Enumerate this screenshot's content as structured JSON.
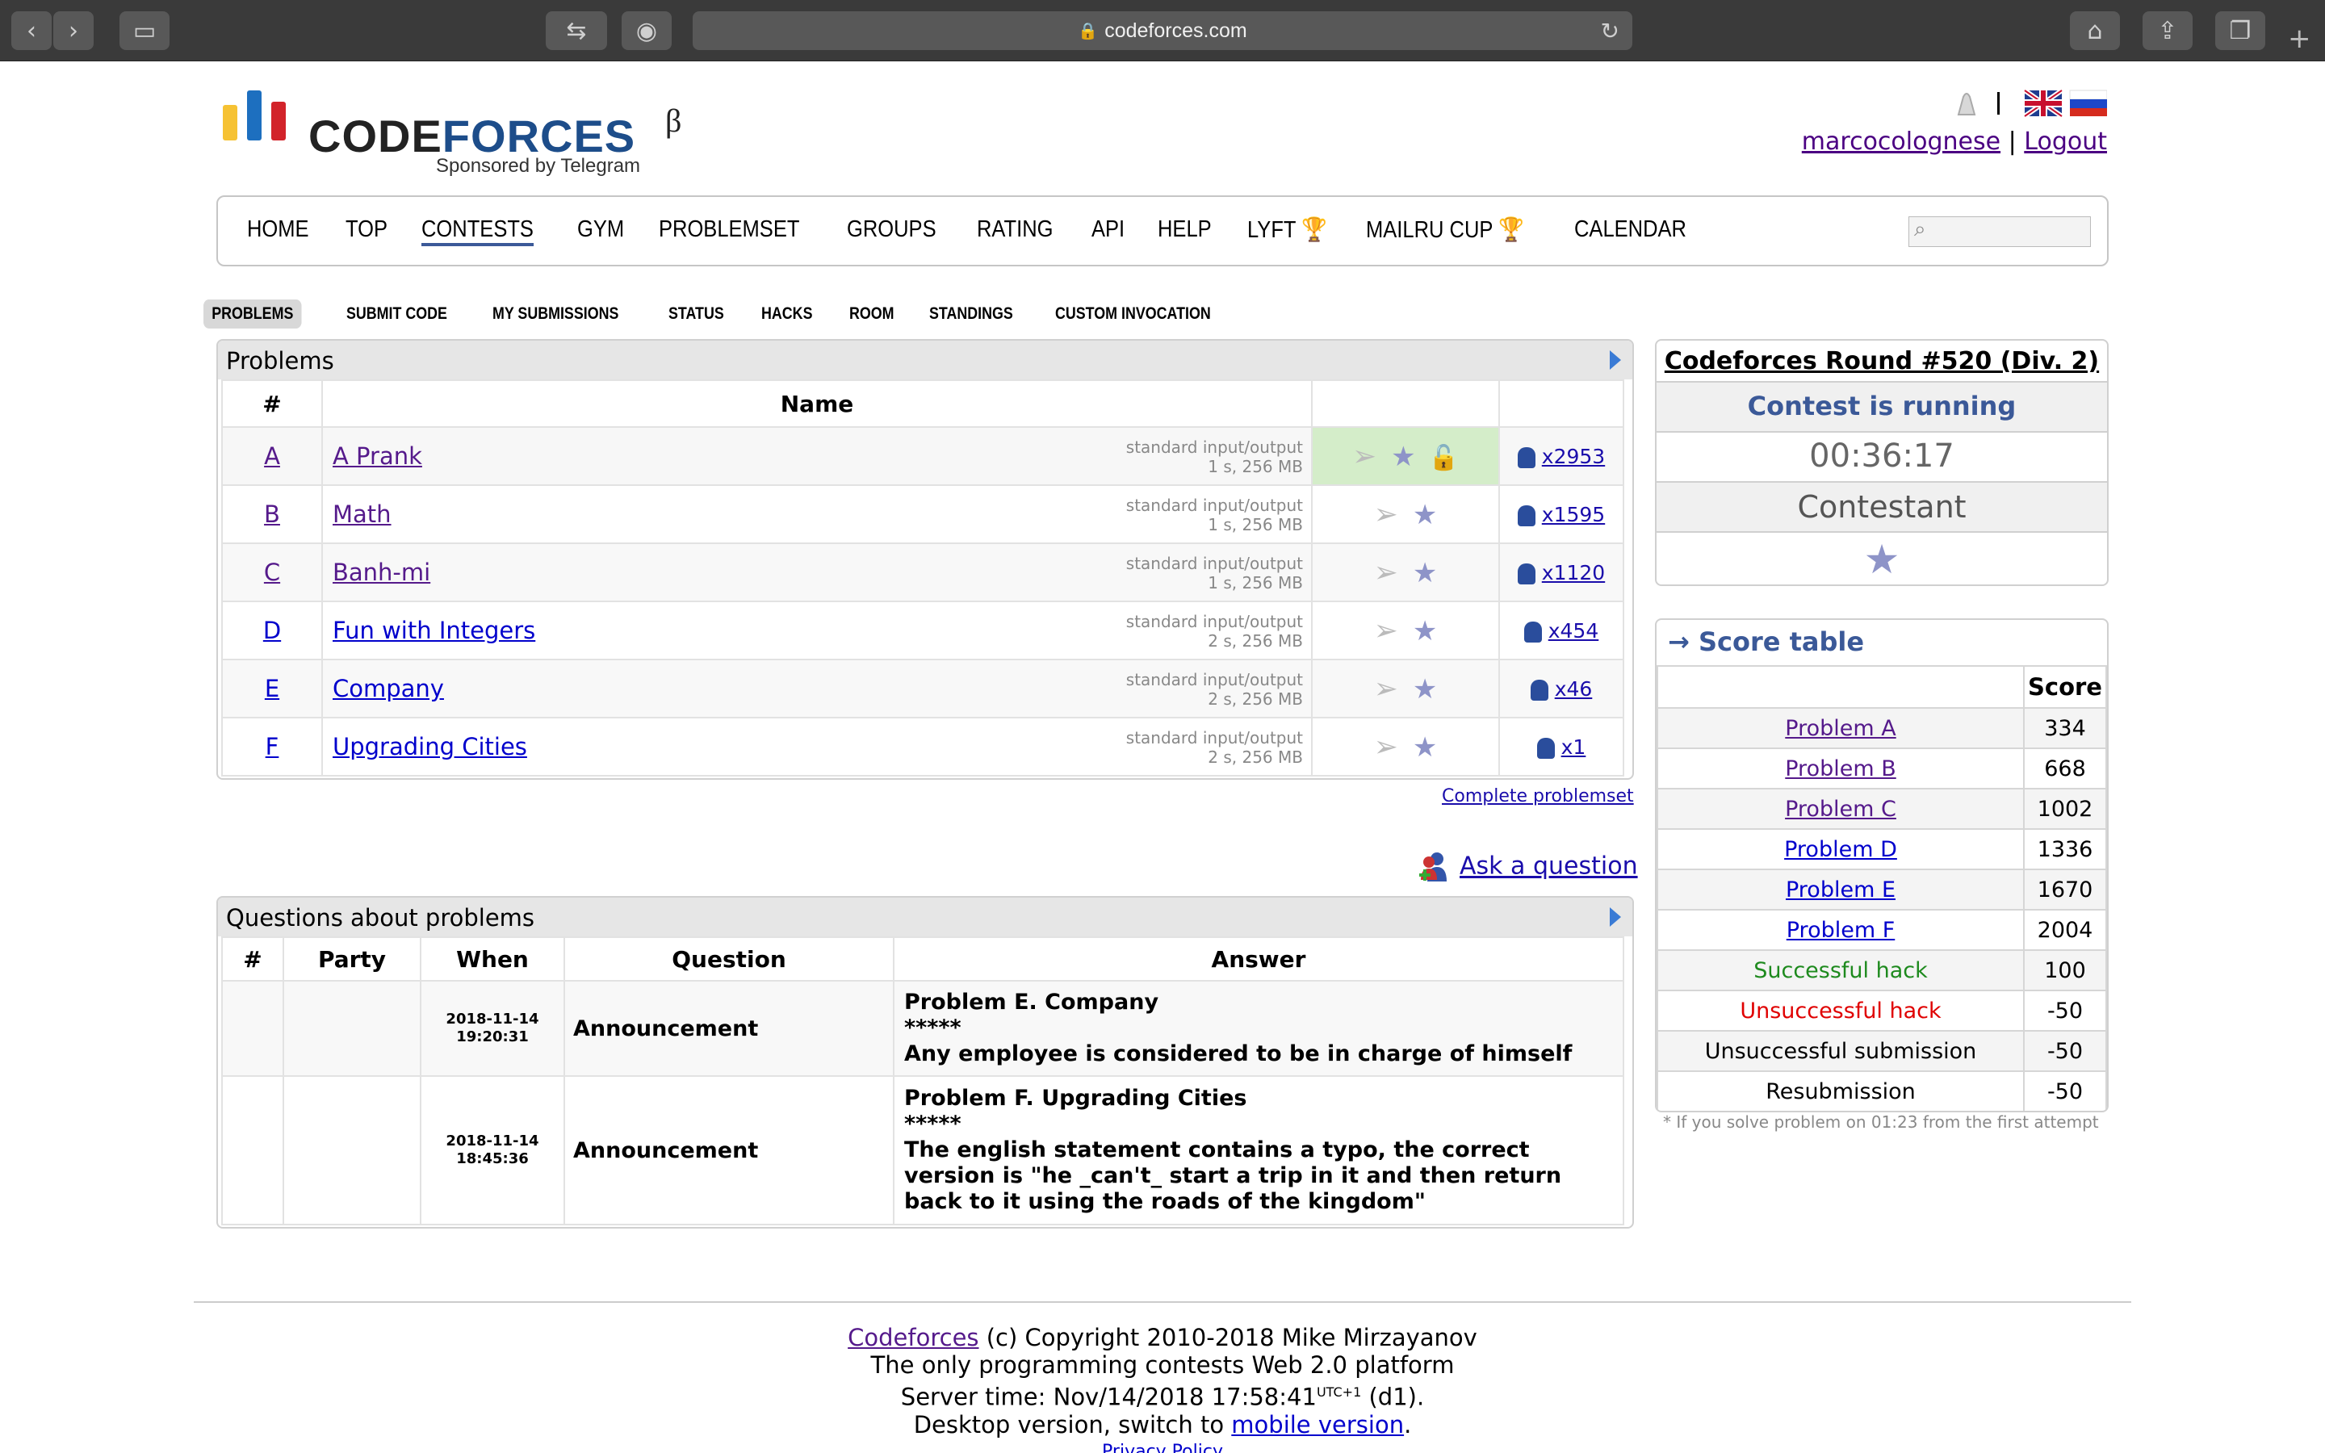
{
  "browser": {
    "url": "codeforces.com"
  },
  "header": {
    "logo_main": "CODE",
    "logo_forces": "FORCES",
    "logo_beta": "β",
    "logo_sponsor": "Sponsored by Telegram",
    "username": "marcocolognese",
    "logout": "Logout",
    "separator": "|"
  },
  "menu": {
    "items": [
      "HOME",
      "TOP",
      "CONTESTS",
      "GYM",
      "PROBLEMSET",
      "GROUPS",
      "RATING",
      "API",
      "HELP",
      "LYFT",
      "MAILRU CUP",
      "CALENDAR"
    ],
    "active": "CONTESTS"
  },
  "submenu": {
    "items": [
      "PROBLEMS",
      "SUBMIT CODE",
      "MY SUBMISSIONS",
      "STATUS",
      "HACKS",
      "ROOM",
      "STANDINGS",
      "CUSTOM INVOCATION"
    ]
  },
  "problems": {
    "caption": "Problems",
    "col_num": "#",
    "col_name": "Name",
    "rows": [
      {
        "idx": "A",
        "name": "A Prank",
        "io": "standard input/output",
        "limits": "1 s, 256 MB",
        "solved": "x2953"
      },
      {
        "idx": "B",
        "name": "Math",
        "io": "standard input/output",
        "limits": "1 s, 256 MB",
        "solved": "x1595"
      },
      {
        "idx": "C",
        "name": "Banh-mi",
        "io": "standard input/output",
        "limits": "1 s, 256 MB",
        "solved": "x1120"
      },
      {
        "idx": "D",
        "name": "Fun with Integers",
        "io": "standard input/output",
        "limits": "2 s, 256 MB",
        "solved": "x454"
      },
      {
        "idx": "E",
        "name": "Company",
        "io": "standard input/output",
        "limits": "2 s, 256 MB",
        "solved": "x46"
      },
      {
        "idx": "F",
        "name": "Upgrading Cities",
        "io": "standard input/output",
        "limits": "2 s, 256 MB",
        "solved": "x1"
      }
    ],
    "complete_link": "Complete problemset",
    "ask_link": "Ask a question"
  },
  "questions": {
    "caption": "Questions about problems",
    "cols": [
      "#",
      "Party",
      "When",
      "Question",
      "Answer"
    ],
    "rows": [
      {
        "date": "2018-11-14",
        "time": "19:20:31",
        "question": "Announcement",
        "title": "Problem E. Company",
        "stars": "*****",
        "body": "Any employee is considered to be in charge of himself"
      },
      {
        "date": "2018-11-14",
        "time": "18:45:36",
        "question": "Announcement",
        "title": "Problem F. Upgrading Cities",
        "stars": "*****",
        "body": "The english statement contains a typo, the correct version is \"he _can't_ start a trip in it and then return back to it using the roads of the kingdom\""
      }
    ]
  },
  "contest": {
    "title": "Codeforces Round #520 (Div. 2)",
    "status": "Contest is running",
    "timer": "00:36:17",
    "role": "Contestant"
  },
  "score": {
    "caption": "→ Score table",
    "col_score": "Score",
    "rows": [
      {
        "label": "Problem A",
        "value": "334"
      },
      {
        "label": "Problem B",
        "value": "668"
      },
      {
        "label": "Problem C",
        "value": "1002"
      },
      {
        "label": "Problem D",
        "value": "1336"
      },
      {
        "label": "Problem E",
        "value": "1670"
      },
      {
        "label": "Problem F",
        "value": "2004"
      },
      {
        "label": "Successful hack",
        "value": "100"
      },
      {
        "label": "Unsuccessful hack",
        "value": "-50"
      },
      {
        "label": "Unsuccessful submission",
        "value": "-50"
      },
      {
        "label": "Resubmission",
        "value": "-50"
      }
    ],
    "note": "* If you solve problem on 01:23 from the first attempt"
  },
  "footer": {
    "cf_link": "Codeforces",
    "copyright": " (c) Copyright 2010-2018 Mike Mirzayanov",
    "line2": "The only programming contests Web 2.0 platform",
    "server_time": "Server time: Nov/14/2018 17:58:41",
    "utc": "UTC+1",
    "d1": " (d1).",
    "desktop": "Desktop version, switch to ",
    "mobile": "mobile version",
    "period": ".",
    "privacy": "Privacy Policy"
  },
  "colors": {
    "accent": "#3b5998",
    "solved_green": "#d4edc9",
    "hack_success": "#1e8a1e",
    "hack_fail": "#e00000"
  }
}
